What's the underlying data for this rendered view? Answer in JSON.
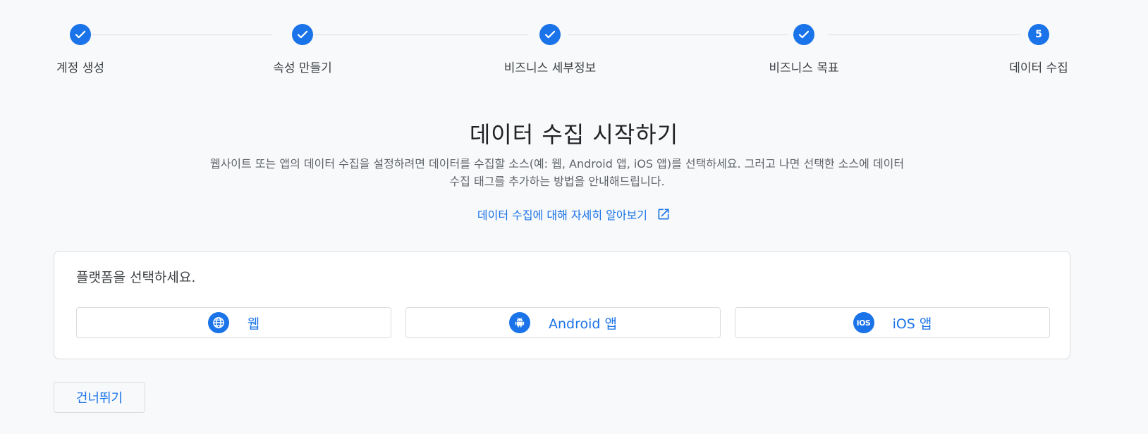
{
  "stepper": {
    "steps": [
      {
        "label": "계정 생성",
        "status": "complete"
      },
      {
        "label": "속성 만들기",
        "status": "complete"
      },
      {
        "label": "비즈니스 세부정보",
        "status": "complete"
      },
      {
        "label": "비즈니스 목표",
        "status": "complete"
      },
      {
        "label": "데이터 수집",
        "status": "current",
        "number": "5"
      }
    ]
  },
  "main": {
    "heading": "데이터 수집 시작하기",
    "description": "웹사이트 또는 앱의 데이터 수집을 설정하려면 데이터를 수집할 소스(예: 웹, Android 앱, iOS 앱)를 선택하세요. 그러고 나면 선택한 소스에 데이터 수집 태그를 추가하는 방법을 안내해드립니다.",
    "learn_more": "데이터 수집에 대해 자세히 알아보기"
  },
  "platform_card": {
    "title": "플랫폼을 선택하세요.",
    "buttons": [
      {
        "label": "웹",
        "icon": "globe-icon"
      },
      {
        "label": "Android 앱",
        "icon": "android-icon"
      },
      {
        "label": "iOS 앱",
        "icon": "ios-icon",
        "icon_text": "iOS"
      }
    ]
  },
  "footer": {
    "skip_label": "건너뛰기"
  },
  "colors": {
    "accent": "#1a73e8",
    "background": "#f8f9fa",
    "border": "#dadce0"
  }
}
